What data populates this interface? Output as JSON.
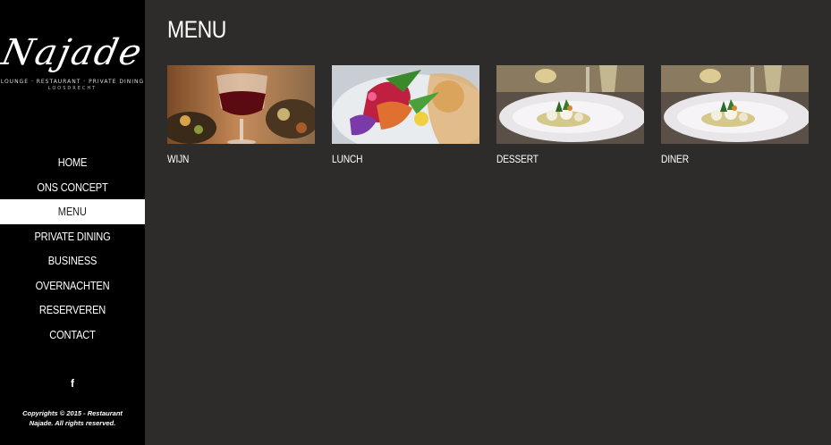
{
  "logo": {
    "name": "Najade",
    "tagline": "LOUNGE · RESTAURANT · PRIVATE DINING",
    "location": "LOOSDRECHT"
  },
  "nav": {
    "items": [
      {
        "label": "HOME"
      },
      {
        "label": "ONS CONCEPT"
      },
      {
        "label": "MENU",
        "active": true
      },
      {
        "label": "PRIVATE DINING"
      },
      {
        "label": "BUSINESS"
      },
      {
        "label": "OVERNACHTEN"
      },
      {
        "label": "RESERVEREN"
      },
      {
        "label": "CONTACT"
      }
    ]
  },
  "social": {
    "facebook_icon": "facebook-icon",
    "facebook_glyph": "f"
  },
  "footer": {
    "copyright_line1": "Copyrights © 2015 - Restaurant",
    "copyright_line2": "Najade.   All rights reserved."
  },
  "main": {
    "title": "MENU",
    "cards": [
      {
        "label": "WIJN"
      },
      {
        "label": "LUNCH"
      },
      {
        "label": "DESSERT"
      },
      {
        "label": "DINER"
      }
    ]
  },
  "colors": {
    "sidebar_bg": "#000000",
    "content_bg": "#2d2c2b",
    "active_nav_bg": "#ffffff",
    "text": "#ffffff"
  }
}
